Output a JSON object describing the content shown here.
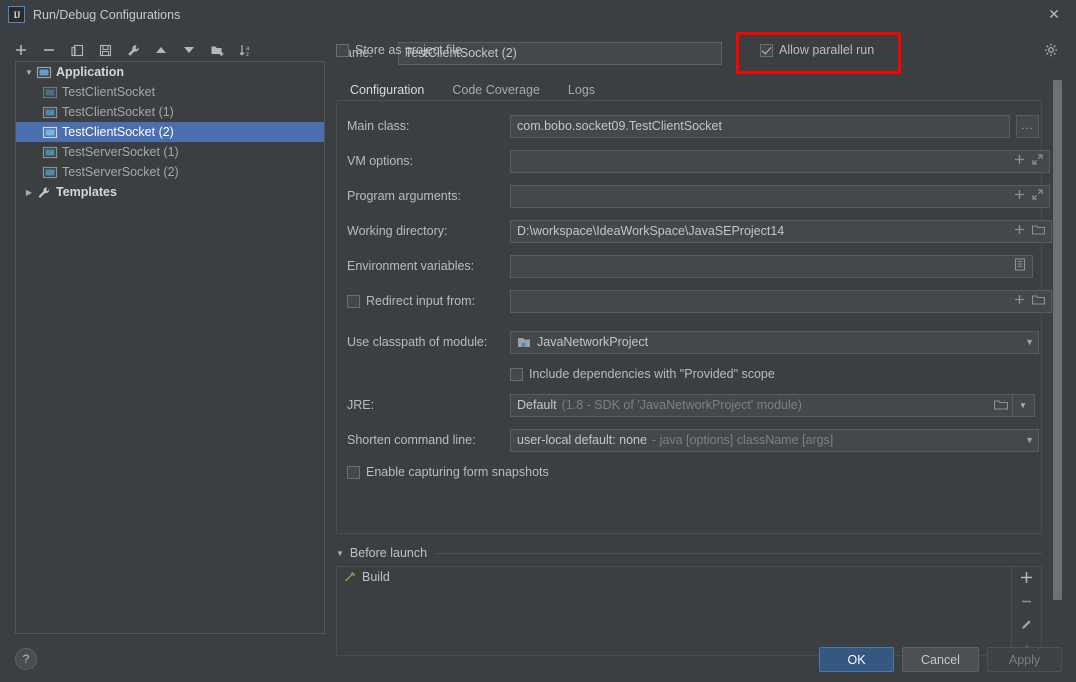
{
  "window": {
    "title": "Run/Debug Configurations",
    "app_icon": "intellij-idea-icon",
    "close_label": "✕"
  },
  "toolbar": {
    "buttons": [
      {
        "name": "add-configuration",
        "icon": "plus-icon",
        "label": "+"
      },
      {
        "name": "remove-configuration",
        "icon": "minus-icon",
        "label": "−"
      },
      {
        "name": "copy-configuration",
        "icon": "copy-icon",
        "label": "copy"
      },
      {
        "name": "save-configuration",
        "icon": "save-icon",
        "label": "save"
      },
      {
        "name": "edit-templates",
        "icon": "wrench-icon",
        "label": "wrench"
      },
      {
        "name": "move-up",
        "icon": "arrow-up-icon",
        "label": "▲"
      },
      {
        "name": "move-down",
        "icon": "arrow-down-icon",
        "label": "▼"
      },
      {
        "name": "new-folder",
        "icon": "folder-add-icon",
        "label": "folder+"
      },
      {
        "name": "sort-alphabetically",
        "icon": "sort-az-icon",
        "label": "sort"
      }
    ]
  },
  "tree": {
    "nodes": [
      {
        "label": "Application",
        "type": "group",
        "expanded": true,
        "icon": "application-icon",
        "selected": false
      },
      {
        "label": "TestClientSocket",
        "type": "leaf",
        "icon": "application-icon",
        "selected": false
      },
      {
        "label": "TestClientSocket (1)",
        "type": "leaf",
        "icon": "application-icon",
        "selected": false
      },
      {
        "label": "TestClientSocket (2)",
        "type": "leaf",
        "icon": "application-icon",
        "selected": true
      },
      {
        "label": "TestServerSocket (1)",
        "type": "leaf",
        "icon": "application-icon",
        "selected": false
      },
      {
        "label": "TestServerSocket (2)",
        "type": "leaf",
        "icon": "application-icon",
        "selected": false
      },
      {
        "label": "Templates",
        "type": "group",
        "expanded": false,
        "icon": "wrench-icon",
        "selected": false
      }
    ]
  },
  "header": {
    "name_label": "Name:",
    "name_value": "TestClientSocket (2)",
    "allow_parallel_run": {
      "label": "Allow parallel run",
      "checked": true
    },
    "store_as_project_file": {
      "label": "Store as project file",
      "checked": false
    },
    "gear_icon": "gear-icon",
    "highlight_color": "#ff0000"
  },
  "tabs": [
    {
      "label": "Configuration",
      "active": true
    },
    {
      "label": "Code Coverage",
      "active": false
    },
    {
      "label": "Logs",
      "active": false
    }
  ],
  "fields": {
    "main_class": {
      "label": "Main class:",
      "value": "com.bobo.socket09.TestClientSocket",
      "browse_label": "..."
    },
    "vm_options": {
      "label": "VM options:",
      "value": "",
      "addon_icons": [
        "plus-icon",
        "expand-icon"
      ]
    },
    "program_arguments": {
      "label": "Program arguments:",
      "value": "",
      "addon_icons": [
        "plus-icon",
        "expand-icon"
      ]
    },
    "working_directory": {
      "label": "Working directory:",
      "value": "D:\\workspace\\IdeaWorkSpace\\JavaSEProject14",
      "addon_icons": [
        "plus-icon",
        "folder-icon"
      ]
    },
    "environment_variables": {
      "label": "Environment variables:",
      "value": "",
      "addon_icons": [
        "list-icon"
      ]
    },
    "redirect_input": {
      "label": "Redirect input from:",
      "checked": false,
      "value": "",
      "addon_icons": [
        "plus-icon",
        "folder-icon"
      ]
    },
    "classpath_module": {
      "label": "Use classpath of module:",
      "value": "JavaNetworkProject",
      "icon": "module-icon"
    },
    "include_provided": {
      "label": "Include dependencies with \"Provided\" scope",
      "checked": false
    },
    "jre": {
      "label": "JRE:",
      "value": "Default",
      "hint": "(1.8 - SDK of 'JavaNetworkProject' module)",
      "addon_icons": [
        "folder-icon",
        "chevron-down-icon"
      ]
    },
    "shorten_command_line": {
      "label": "Shorten command line:",
      "value": "user-local default: none",
      "hint": "- java [options] className [args]"
    },
    "enable_snapshots": {
      "label": "Enable capturing form snapshots",
      "checked": false
    }
  },
  "before_launch": {
    "title": "Before launch",
    "expanded": true,
    "items": [
      {
        "label": "Build",
        "icon": "build-hammer-icon"
      }
    ],
    "side_buttons": [
      {
        "name": "add-task",
        "icon": "plus-icon",
        "label": "+"
      },
      {
        "name": "remove-task",
        "icon": "minus-icon",
        "label": "−"
      },
      {
        "name": "edit-task",
        "icon": "pencil-icon",
        "label": "edit"
      },
      {
        "name": "move-task-up",
        "icon": "arrow-up-icon",
        "label": "▲"
      }
    ]
  },
  "footer": {
    "help_label": "?",
    "ok_label": "OK",
    "cancel_label": "Cancel",
    "apply_label": "Apply",
    "apply_disabled": true
  }
}
